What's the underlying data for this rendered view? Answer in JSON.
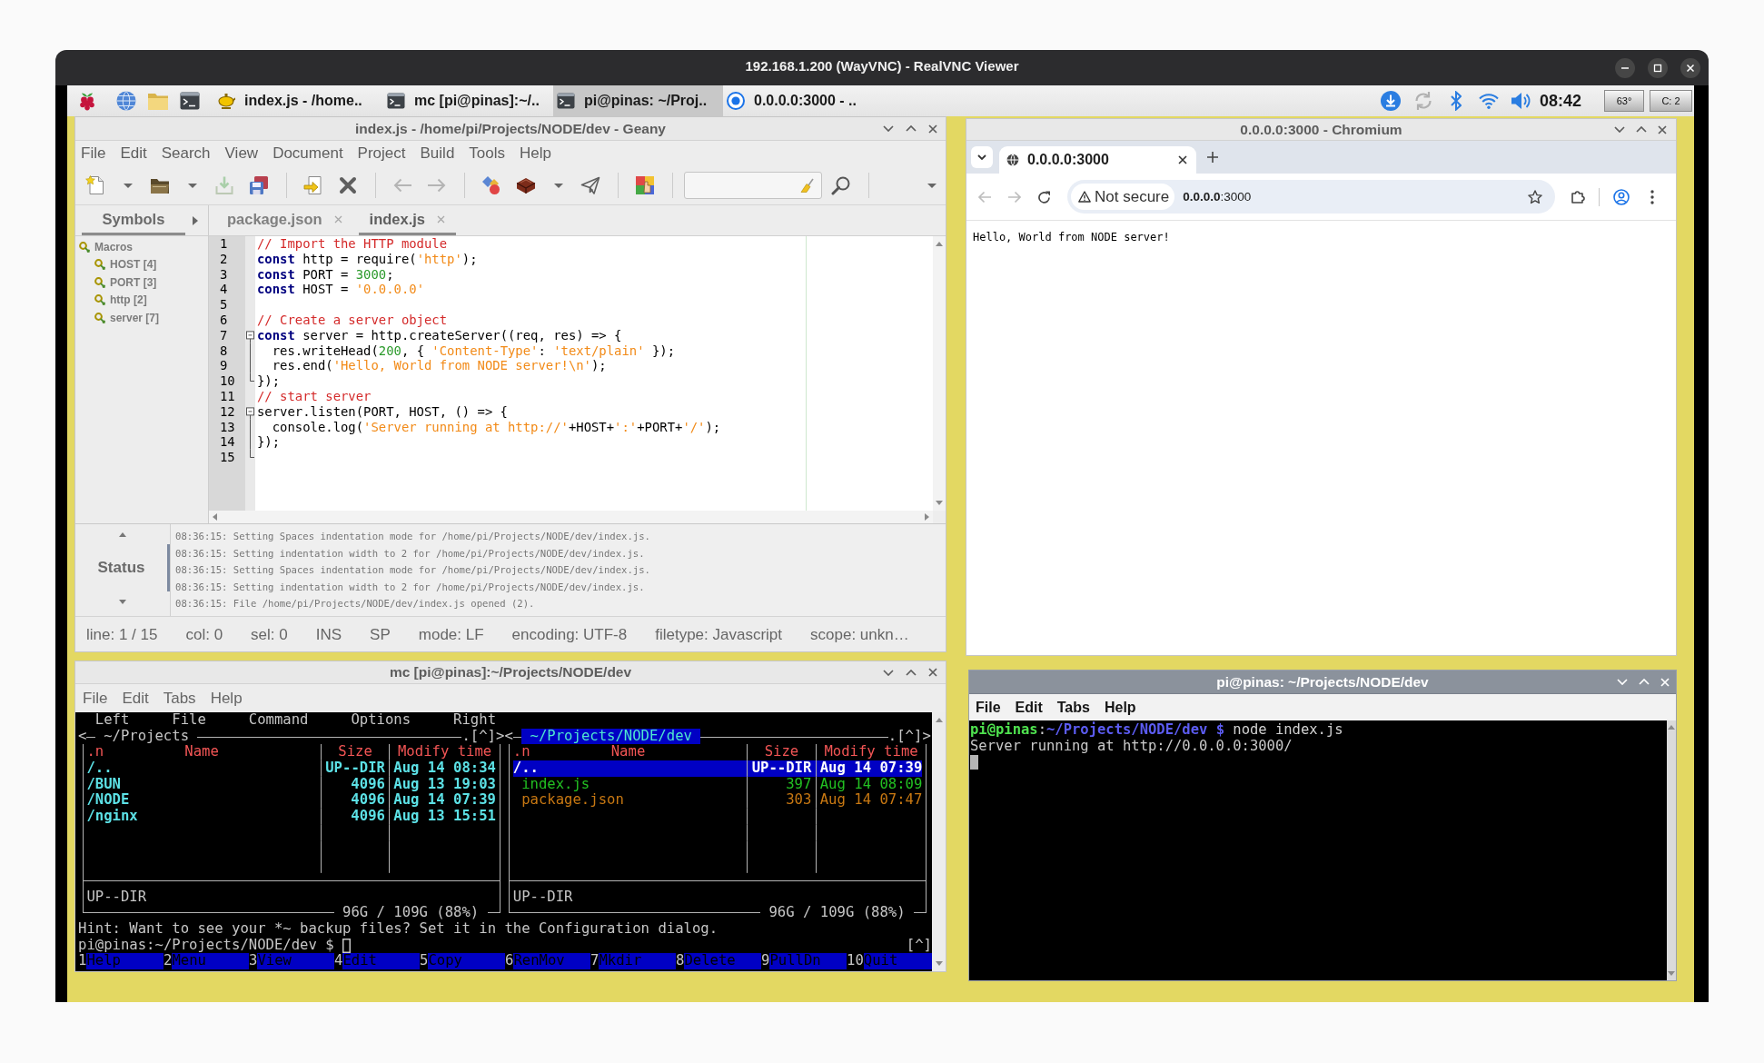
{
  "viewer": {
    "title": "192.168.1.200 (WayVNC) - RealVNC Viewer"
  },
  "taskbar": {
    "tasks": [
      {
        "kind": "geany",
        "label": "index.js - /home..",
        "selected": false
      },
      {
        "kind": "terminal",
        "label": "mc [pi@pinas]:~/..",
        "selected": false
      },
      {
        "kind": "terminal",
        "label": "pi@pinas: ~/Proj..",
        "selected": true
      },
      {
        "kind": "browser",
        "label": "0.0.0.0:3000 - ..",
        "selected": false
      }
    ],
    "clock": "08:42",
    "temperature": "63°",
    "indicator": "C: 2"
  },
  "geany": {
    "title": "index.js - /home/pi/Projects/NODE/dev - Geany",
    "active": false,
    "menu": [
      "File",
      "Edit",
      "Search",
      "View",
      "Document",
      "Project",
      "Build",
      "Tools",
      "Help"
    ],
    "toolbar": [
      {
        "kind": "new",
        "disabled": false,
        "menu": true
      },
      {
        "kind": "open",
        "disabled": false,
        "menu": true
      },
      {
        "kind": "save",
        "disabled": true
      },
      {
        "kind": "save_all",
        "disabled": false
      },
      {
        "kind": "separator"
      },
      {
        "kind": "reload",
        "disabled": false
      },
      {
        "kind": "close",
        "disabled": false
      },
      {
        "kind": "separator"
      },
      {
        "kind": "back",
        "disabled": true
      },
      {
        "kind": "forward",
        "disabled": true
      },
      {
        "kind": "separator"
      },
      {
        "kind": "compile",
        "disabled": false
      },
      {
        "kind": "build",
        "disabled": false,
        "menu": true
      },
      {
        "kind": "run",
        "disabled": false
      },
      {
        "kind": "separator"
      },
      {
        "kind": "color",
        "disabled": false
      },
      {
        "kind": "separator"
      },
      {
        "kind": "search_field"
      },
      {
        "kind": "find",
        "disabled": false
      },
      {
        "kind": "separator"
      },
      {
        "kind": "overflow"
      }
    ],
    "sidebar": {
      "tab": {
        "label": "Symbols",
        "selected": true
      },
      "tree": [
        {
          "label": "Macros",
          "children": [
            {
              "label": "HOST [4]"
            },
            {
              "label": "PORT [3]"
            },
            {
              "label": "http [2]"
            },
            {
              "label": "server [7]"
            }
          ]
        }
      ]
    },
    "tabs": [
      {
        "label": "package.json",
        "selected": false
      },
      {
        "label": "index.js",
        "selected": true
      }
    ],
    "code": [
      {
        "number": "1",
        "tokens": [
          {
            "kind": "comment",
            "text": "// Import the HTTP module"
          }
        ]
      },
      {
        "number": "2",
        "tokens": [
          {
            "kind": "keyword",
            "text": "const"
          },
          {
            "kind": "plain",
            "text": " http = require("
          },
          {
            "kind": "string",
            "text": "'http'"
          },
          {
            "kind": "plain",
            "text": ");"
          }
        ]
      },
      {
        "number": "3",
        "tokens": [
          {
            "kind": "keyword",
            "text": "const"
          },
          {
            "kind": "plain",
            "text": " PORT = "
          },
          {
            "kind": "number",
            "text": "3000"
          },
          {
            "kind": "plain",
            "text": ";"
          }
        ]
      },
      {
        "number": "4",
        "tokens": [
          {
            "kind": "keyword",
            "text": "const"
          },
          {
            "kind": "plain",
            "text": " HOST = "
          },
          {
            "kind": "string",
            "text": "'0.0.0.0'"
          }
        ]
      },
      {
        "number": "5"
      },
      {
        "number": "6",
        "tokens": [
          {
            "kind": "comment",
            "text": "// Create a server object"
          }
        ]
      },
      {
        "number": "7",
        "fold_start": true,
        "expanded": true,
        "tokens": [
          {
            "kind": "keyword",
            "text": "const"
          },
          {
            "kind": "plain",
            "text": " server = http.createServer((req, res) => {"
          }
        ]
      },
      {
        "number": "8",
        "fold_guide": true,
        "tokens": [
          {
            "kind": "plain",
            "text": "  res.writeHead("
          },
          {
            "kind": "number",
            "text": "200"
          },
          {
            "kind": "plain",
            "text": ", { "
          },
          {
            "kind": "string",
            "text": "'Content-Type'"
          },
          {
            "kind": "plain",
            "text": ": "
          },
          {
            "kind": "string",
            "text": "'text/plain'"
          },
          {
            "kind": "plain",
            "text": " });"
          }
        ]
      },
      {
        "number": "9",
        "fold_guide": true,
        "tokens": [
          {
            "kind": "plain",
            "text": "  res.end("
          },
          {
            "kind": "string",
            "text": "'Hello, World from NODE server!\\n'"
          },
          {
            "kind": "plain",
            "text": ");"
          }
        ]
      },
      {
        "number": "10",
        "fold_end": true,
        "tokens": [
          {
            "kind": "plain",
            "text": "});"
          }
        ]
      },
      {
        "number": "11",
        "tokens": [
          {
            "kind": "comment",
            "text": "// start server"
          }
        ]
      },
      {
        "number": "12",
        "fold_start": true,
        "expanded": true,
        "tokens": [
          {
            "kind": "plain",
            "text": "server.listen(PORT, HOST, () => {"
          }
        ]
      },
      {
        "number": "13",
        "fold_guide": true,
        "tokens": [
          {
            "kind": "plain",
            "text": "  console.log("
          },
          {
            "kind": "string",
            "text": "'Server running at http://'"
          },
          {
            "kind": "plain",
            "text": "+HOST+"
          },
          {
            "kind": "string",
            "text": "':'"
          },
          {
            "kind": "plain",
            "text": "+PORT+"
          },
          {
            "kind": "string",
            "text": "'/'"
          },
          {
            "kind": "plain",
            "text": ");"
          }
        ]
      },
      {
        "number": "14",
        "fold_guide": true,
        "tokens": [
          {
            "kind": "plain",
            "text": "});"
          }
        ]
      },
      {
        "number": "15",
        "fold_end": true
      }
    ],
    "messages": {
      "tab": {
        "label": "Status",
        "selected": true
      },
      "lines": [
        "08:36:15: Setting Spaces indentation mode for /home/pi/Projects/NODE/dev/index.js.",
        "08:36:15: Setting indentation width to 2 for /home/pi/Projects/NODE/dev/index.js.",
        "08:36:15: Setting Spaces indentation mode for /home/pi/Projects/NODE/dev/index.js.",
        "08:36:15: Setting indentation width to 2 for /home/pi/Projects/NODE/dev/index.js.",
        "08:36:15: File /home/pi/Projects/NODE/dev/index.js opened (2)."
      ]
    },
    "status_bar": [
      "line: 1 / 15",
      "col: 0",
      "sel: 0",
      "INS",
      "SP",
      "mode: LF",
      "encoding: UTF-8",
      "filetype: Javascript",
      "scope: unkn…"
    ]
  },
  "chromium": {
    "title": "0.0.0.0:3000 - Chromium",
    "active": false,
    "tabs": [
      {
        "label": "0.0.0.0:3000",
        "selected": true
      }
    ],
    "nav": [
      {
        "kind": "back",
        "disabled": true
      },
      {
        "kind": "forward",
        "disabled": true
      },
      {
        "kind": "reload",
        "disabled": false
      }
    ],
    "security": "Not secure",
    "url": "**0.0.0.0**:3000",
    "page_text": "Hello, World from NODE server!"
  },
  "mc": {
    "title": "mc [pi@pinas]:~/Projects/NODE/dev",
    "active": false,
    "menu": [
      "File",
      "Edit",
      "Tabs",
      "Help"
    ],
    "menubar": [
      "Left",
      "File",
      "Command",
      "Options",
      "Right"
    ],
    "panels": [
      {
        "active": false,
        "history": "<",
        "path": "~/Projects",
        "controls": ".[^]>",
        "sort": ".n",
        "columns": [
          "Name",
          "Size",
          "Modify time"
        ],
        "rows": [
          {
            "kind": "dir",
            "name": "/..",
            "size": "UP--DIR",
            "time": "Aug 14 08:34",
            "color": "#5ce1e6",
            "selected": false
          },
          {
            "kind": "dir",
            "name": "/BUN",
            "size": "4096",
            "time": "Aug 13 19:03",
            "color": "#5ce1e6",
            "selected": false
          },
          {
            "kind": "dir",
            "name": "/NODE",
            "size": "4096",
            "time": "Aug 14 07:39",
            "color": "#5ce1e6",
            "selected": false
          },
          {
            "kind": "dir",
            "name": "/nginx",
            "size": "4096",
            "time": "Aug 13 15:51",
            "color": "#5ce1e6",
            "selected": false
          }
        ],
        "info": "UP--DIR",
        "disk": "96G / 109G (88%)"
      },
      {
        "active": true,
        "history": "<",
        "path": "~/Projects/NODE/dev",
        "controls": ".[^]>",
        "sort": ".n",
        "columns": [
          "Name",
          "Size",
          "Modify time"
        ],
        "rows": [
          {
            "kind": "dir",
            "name": "/..",
            "size": "UP--DIR",
            "time": "Aug 14 07:39",
            "selected": true
          },
          {
            "kind": "file",
            "name": "index.js",
            "size": "397",
            "time": "Aug 14 08:09",
            "color": "#22c022",
            "selected": false
          },
          {
            "kind": "file",
            "name": "package.json",
            "size": "303",
            "time": "Aug 14 07:47",
            "color": "#c87812",
            "selected": false
          }
        ],
        "info": "UP--DIR",
        "disk": "96G / 109G (88%)"
      }
    ],
    "hint": "Hint: Want to see your *~ backup files? Set it in the Configuration dialog.",
    "prompt": "pi@pinas:~/Projects/NODE/dev $",
    "cursor": true,
    "prompt_marker": "[^]",
    "keys": [
      {
        "key": "1",
        "label": "Help"
      },
      {
        "key": "2",
        "label": "Menu"
      },
      {
        "key": "3",
        "label": "View"
      },
      {
        "key": "4",
        "label": "Edit"
      },
      {
        "key": "5",
        "label": "Copy"
      },
      {
        "key": "6",
        "label": "RenMov"
      },
      {
        "key": "7",
        "label": "Mkdir"
      },
      {
        "key": "8",
        "label": "Delete"
      },
      {
        "key": "9",
        "label": "PullDn"
      },
      {
        "key": "10",
        "label": "Quit"
      }
    ]
  },
  "terminal": {
    "title": "pi@pinas: ~/Projects/NODE/dev",
    "active": true,
    "menu": [
      "File",
      "Edit",
      "Tabs",
      "Help"
    ],
    "lines": [
      {
        "kind": "prompt",
        "parts": [
          {
            "kind": "user",
            "text": "pi@pinas"
          },
          {
            "kind": "plain",
            "text": ":"
          },
          {
            "kind": "path",
            "text": "~/Projects/NODE/dev $"
          },
          {
            "kind": "plain",
            "text": " node index.js"
          }
        ]
      },
      {
        "kind": "output",
        "text": "Server running at http://0.0.0.0:3000/"
      }
    ],
    "cursor": true
  }
}
